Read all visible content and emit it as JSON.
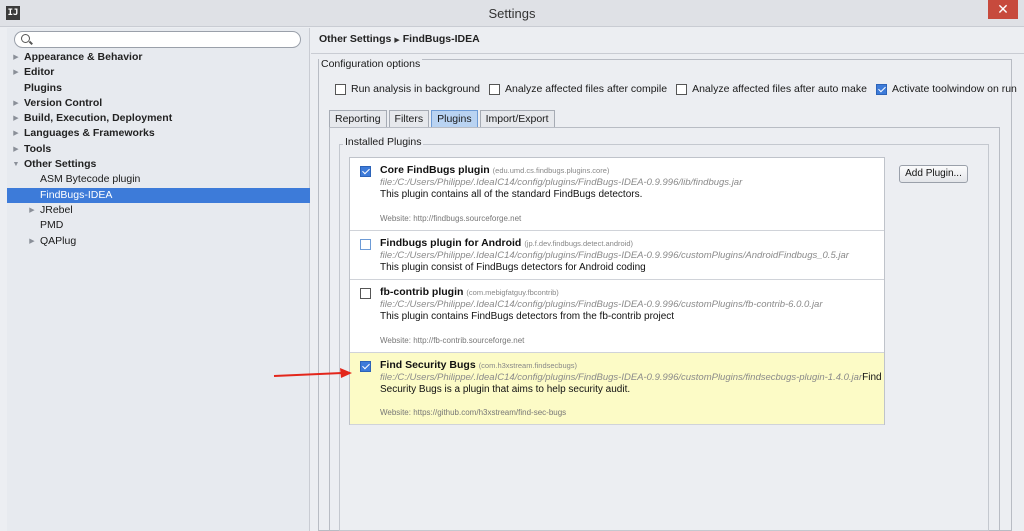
{
  "window": {
    "title": "Settings",
    "app_icon_text": "IJ",
    "close_glyph": "✕"
  },
  "sidebar": {
    "search_placeholder": "",
    "items": [
      {
        "label": "Appearance & Behavior",
        "arrow": "▶",
        "bold": true,
        "level": 0
      },
      {
        "label": "Editor",
        "arrow": "▶",
        "bold": true,
        "level": 0
      },
      {
        "label": "Plugins",
        "arrow": "",
        "bold": true,
        "level": 0
      },
      {
        "label": "Version Control",
        "arrow": "▶",
        "bold": true,
        "level": 0
      },
      {
        "label": "Build, Execution, Deployment",
        "arrow": "▶",
        "bold": true,
        "level": 0
      },
      {
        "label": "Languages & Frameworks",
        "arrow": "▶",
        "bold": true,
        "level": 0
      },
      {
        "label": "Tools",
        "arrow": "▶",
        "bold": true,
        "level": 0
      },
      {
        "label": "Other Settings",
        "arrow": "▼",
        "bold": true,
        "level": 0
      },
      {
        "label": "ASM Bytecode plugin",
        "arrow": "",
        "bold": false,
        "level": 1
      },
      {
        "label": "FindBugs-IDEA",
        "arrow": "",
        "bold": false,
        "level": 1,
        "selected": true
      },
      {
        "label": "JRebel",
        "arrow": "▶",
        "bold": false,
        "level": 1
      },
      {
        "label": "PMD",
        "arrow": "",
        "bold": false,
        "level": 1
      },
      {
        "label": "QAPlug",
        "arrow": "▶",
        "bold": false,
        "level": 1
      }
    ]
  },
  "breadcrumb": {
    "parent": "Other Settings",
    "separator": "▶",
    "current": "FindBugs-IDEA"
  },
  "config": {
    "group_title": "Configuration options",
    "options": [
      {
        "label": "Run analysis in background",
        "checked": false
      },
      {
        "label": "Analyze affected files after compile",
        "checked": false
      },
      {
        "label": "Analyze affected files after auto make",
        "checked": false
      },
      {
        "label": "Activate toolwindow on run",
        "checked": true
      }
    ]
  },
  "tabs": [
    "Reporting",
    "Filters",
    "Plugins",
    "Import/Export"
  ],
  "active_tab": "Plugins",
  "installed": {
    "title": "Installed Plugins",
    "add_button": "Add Plugin...",
    "plugins": [
      {
        "name": "Core FindBugs plugin",
        "id": "(edu.umd.cs.findbugs.plugins.core)",
        "path": "file:/C:/Users/Philippe/.IdeaIC14/config/plugins/FindBugs-IDEA-0.9.996/lib/findbugs.jar",
        "path_tail": "",
        "desc": "This plugin contains all of the standard FindBugs detectors.",
        "website": "Website: http://findbugs.sourceforge.net",
        "checked": true,
        "highlight": false
      },
      {
        "name": "Findbugs plugin for Android",
        "id": "(jp.f.dev.findbugs.detect.android)",
        "path": "file:/C:/Users/Philippe/.IdeaIC14/config/plugins/FindBugs-IDEA-0.9.996/customPlugins/AndroidFindbugs_0.5.jar",
        "path_tail": "",
        "desc": "This plugin consist of FindBugs detectors for Android coding",
        "website": "",
        "checked": false,
        "highlight": false
      },
      {
        "name": "fb-contrib plugin",
        "id": "(com.mebigfatguy.fbcontrib)",
        "path": "file:/C:/Users/Philippe/.IdeaIC14/config/plugins/FindBugs-IDEA-0.9.996/customPlugins/fb-contrib-6.0.0.jar",
        "path_tail": "",
        "desc": "This plugin contains FindBugs detectors from the fb-contrib project",
        "website": "Website: http://fb-contrib.sourceforge.net",
        "checked": false,
        "highlight": false
      },
      {
        "name": "Find Security Bugs",
        "id": "(com.h3xstream.findsecbugs)",
        "path": "file:/C:/Users/Philippe/.IdeaIC14/config/plugins/FindBugs-IDEA-0.9.996/customPlugins/findsecbugs-plugin-1.4.0.jar",
        "path_tail": "Find",
        "desc": "Security Bugs is a plugin that aims to help security audit.",
        "website": "Website: https://github.com/h3xstream/find-sec-bugs",
        "checked": true,
        "highlight": true
      }
    ]
  },
  "colors": {
    "selection": "#3d7bd9",
    "highlight_row": "#fcfbc6",
    "annotation_arrow": "#e3261b"
  }
}
